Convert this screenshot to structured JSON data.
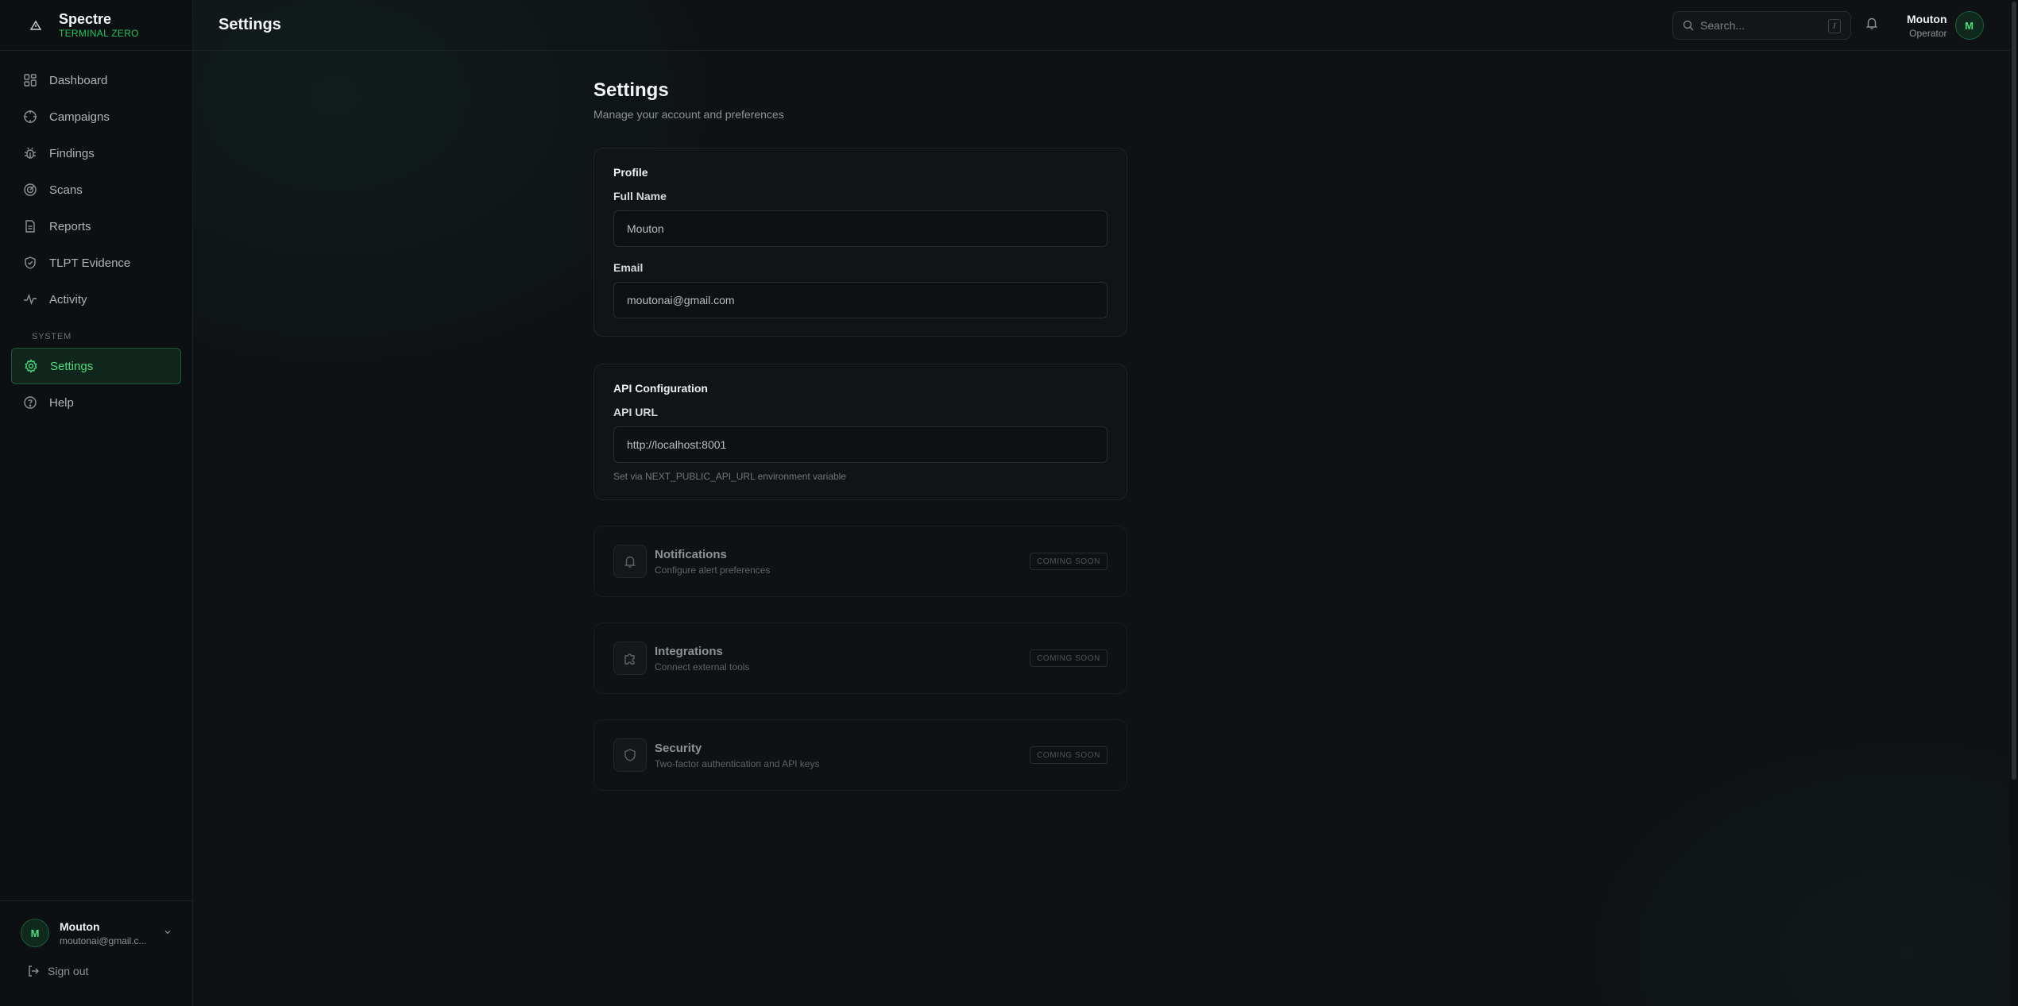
{
  "brand": {
    "name": "Spectre",
    "subtitle": "TERMINAL ZERO",
    "logo_icon": "warning-triangle-icon",
    "accent": "#22c55e"
  },
  "sidebar": {
    "items": [
      {
        "label": "Dashboard",
        "icon": "grid-icon"
      },
      {
        "label": "Campaigns",
        "icon": "crosshair-icon"
      },
      {
        "label": "Findings",
        "icon": "bug-icon"
      },
      {
        "label": "Scans",
        "icon": "radar-icon"
      },
      {
        "label": "Reports",
        "icon": "file-icon"
      },
      {
        "label": "TLPT Evidence",
        "icon": "shield-check-icon"
      },
      {
        "label": "Activity",
        "icon": "activity-icon"
      }
    ],
    "section_label": "SYSTEM",
    "system_items": [
      {
        "label": "Settings",
        "icon": "gear-icon",
        "active": true
      },
      {
        "label": "Help",
        "icon": "help-icon"
      }
    ],
    "user": {
      "initial": "M",
      "name": "Mouton",
      "email": "moutonai@gmail.c..."
    },
    "signout_label": "Sign out"
  },
  "topbar": {
    "title": "Settings",
    "search_placeholder": "Search...",
    "search_shortcut": "/",
    "user": {
      "name": "Mouton",
      "role": "Operator",
      "initial": "M"
    }
  },
  "page": {
    "title": "Settings",
    "subtitle": "Manage your account and preferences",
    "profile": {
      "title": "Profile",
      "full_name_label": "Full Name",
      "full_name_value": "Mouton",
      "email_label": "Email",
      "email_value": "moutonai@gmail.com"
    },
    "api": {
      "title": "API Configuration",
      "url_label": "API URL",
      "url_value": "http://localhost:8001",
      "hint": "Set via NEXT_PUBLIC_API_URL environment variable"
    },
    "coming_soon": [
      {
        "title": "Notifications",
        "desc": "Configure alert preferences",
        "icon": "bell-icon",
        "badge": "COMING SOON"
      },
      {
        "title": "Integrations",
        "desc": "Connect external tools",
        "icon": "puzzle-icon",
        "badge": "COMING SOON"
      },
      {
        "title": "Security",
        "desc": "Two-factor authentication and API keys",
        "icon": "shield-icon",
        "badge": "COMING SOON"
      }
    ]
  }
}
